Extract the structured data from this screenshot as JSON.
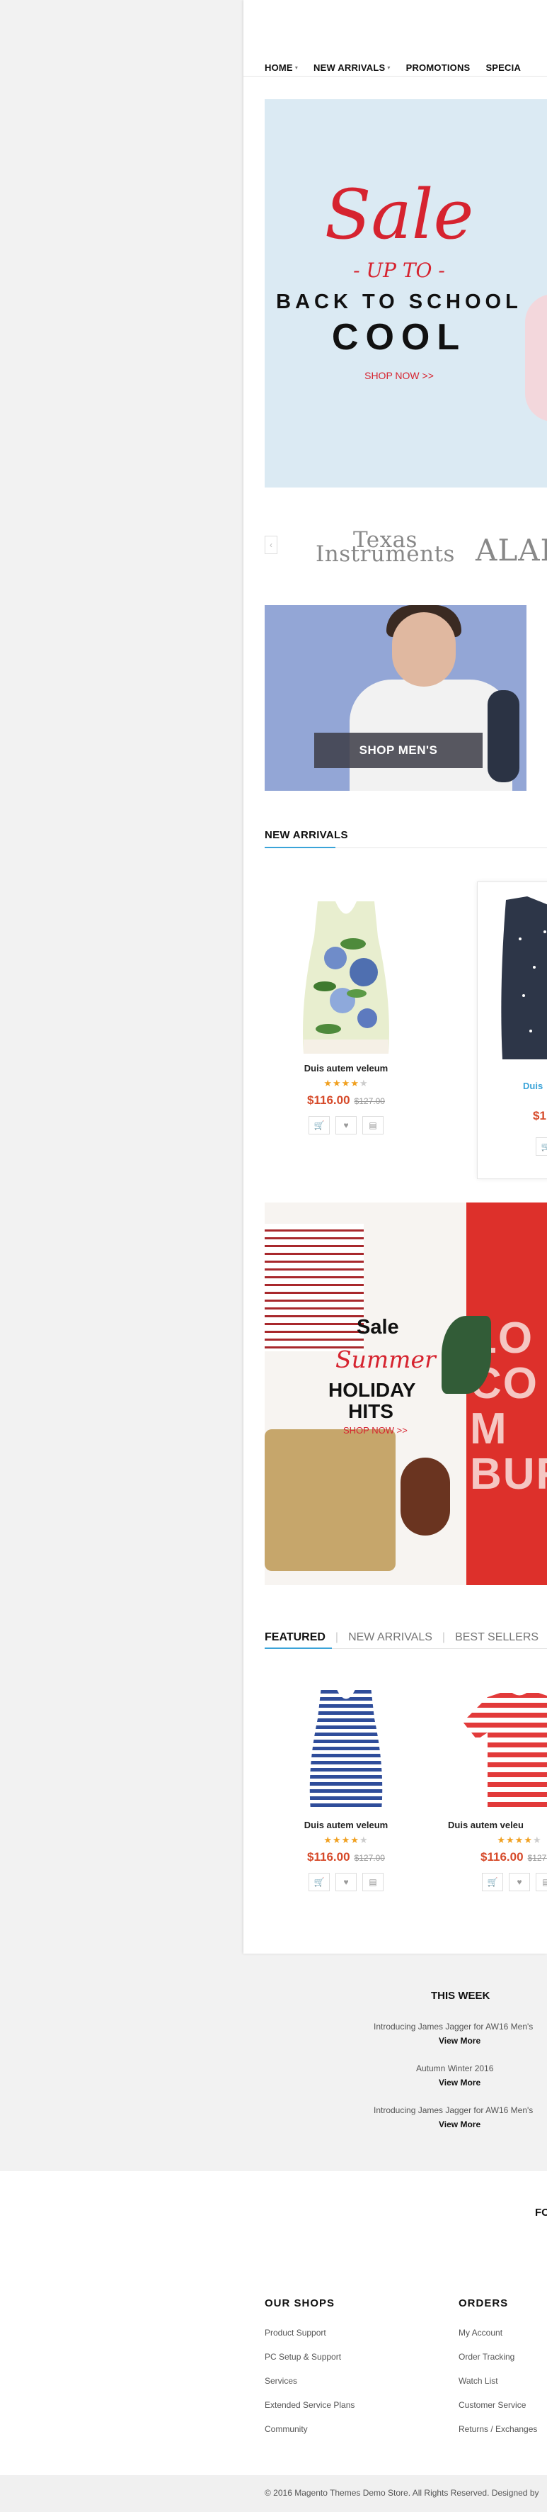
{
  "nav": {
    "items": [
      {
        "label": "HOME",
        "dropdown": true
      },
      {
        "label": "NEW ARRIVALS",
        "dropdown": true
      },
      {
        "label": "PROMOTIONS",
        "dropdown": false
      },
      {
        "label": "SPECIA",
        "dropdown": false
      }
    ]
  },
  "hero": {
    "sale": "Sale",
    "upto": "- UP TO -",
    "line1": "BACK TO SCHOOL",
    "line2": "COOL",
    "cta": "SHOP NOW >>",
    "bg_color": "#dbeaf3",
    "accent_color": "#d6232f"
  },
  "brands": {
    "prev_icon": "chevron-left-icon",
    "texas_line1": "Texas",
    "texas_line2": "Instruments",
    "aladdin": "ALADD"
  },
  "men_banner": {
    "cta": "SHOP MEN'S"
  },
  "new_arrivals": {
    "title": "NEW ARRIVALS",
    "products": [
      {
        "name": "Duis autem veleum",
        "price": "$116.00",
        "old_price": "$127.00",
        "rating": 4,
        "max_rating": 5
      },
      {
        "name": "Duis",
        "price": "$1",
        "old_price": "",
        "rating": 0,
        "max_rating": 5
      }
    ]
  },
  "summer": {
    "sale": "Sale",
    "summer": "Summer",
    "holiday": "HOLIDAY",
    "hits": "HITS",
    "cta": "SHOP NOW >>",
    "graffiti": "LO CO M BUR"
  },
  "tabs": {
    "items": [
      "FEATURED",
      "NEW ARRIVALS",
      "BEST SELLERS"
    ],
    "active": "FEATURED"
  },
  "featured": {
    "products": [
      {
        "name": "Duis autem veleum",
        "price": "$116.00",
        "old_price": "$127.00",
        "rating": 4,
        "max_rating": 5
      },
      {
        "name": "Duis autem veleu",
        "price": "$116.00",
        "old_price": "$127.00",
        "rating": 4,
        "max_rating": 5
      }
    ]
  },
  "this_week": {
    "title": "THIS WEEK",
    "posts": [
      {
        "title": "Introducing James Jagger for AW16 Men's",
        "more": "View More"
      },
      {
        "title": "Autumn Winter 2016",
        "more": "View More"
      },
      {
        "title": "Introducing James Jagger for AW16 Men's",
        "more": "View More"
      }
    ]
  },
  "footer": {
    "cut_heading": "FO",
    "columns": [
      {
        "heading": "OUR SHOPS",
        "links": [
          "Product Support",
          "PC Setup & Support",
          "Services",
          "Extended Service Plans",
          "Community"
        ]
      },
      {
        "heading": "ORDERS",
        "links": [
          "My Account",
          "Order Tracking",
          "Watch List",
          "Customer Service",
          "Returns / Exchanges"
        ]
      }
    ],
    "copyright": "© 2016 Magento Themes Demo Store. All Rights Reserved. Designed by"
  }
}
